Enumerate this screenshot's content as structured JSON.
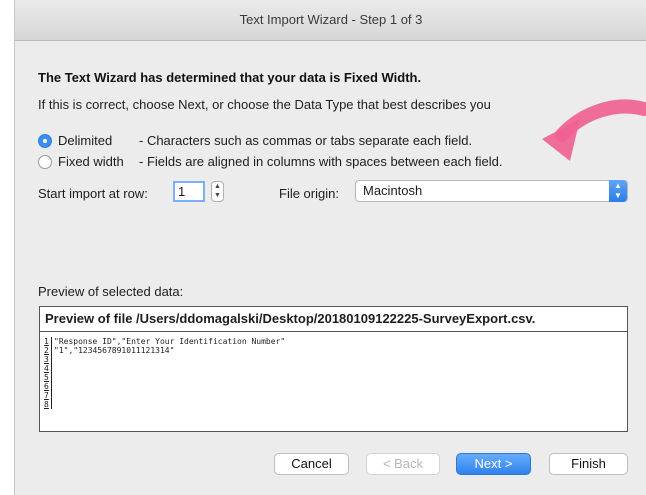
{
  "window": {
    "title": "Text Import Wizard - Step 1 of 3"
  },
  "intro": {
    "heading": "The Text Wizard has determined that your data is Fixed Width.",
    "subheading": "If this is correct, choose Next, or choose the Data Type that best describes you"
  },
  "data_type": {
    "options": [
      {
        "label": "Delimited",
        "description": "- Characters such as commas or tabs separate each field.",
        "selected": true
      },
      {
        "label": "Fixed width",
        "description": "- Fields are aligned in columns with spaces between each field.",
        "selected": false
      }
    ]
  },
  "import": {
    "start_label": "Start import at row:",
    "start_row": "1",
    "origin_label": "File origin:",
    "origin_value": "Macintosh"
  },
  "preview": {
    "label": "Preview of selected data:",
    "header": "Preview of file /Users/ddomagalski/Desktop/20180109122225-SurveyExport.csv.",
    "lines": [
      {
        "num": "1",
        "text": "\"Response ID\",\"Enter Your Identification Number\""
      },
      {
        "num": "2",
        "text": "\"1\",\"1234567891011121314\""
      },
      {
        "num": "3",
        "text": ""
      },
      {
        "num": "4",
        "text": ""
      },
      {
        "num": "5",
        "text": ""
      },
      {
        "num": "6",
        "text": ""
      },
      {
        "num": "7",
        "text": ""
      },
      {
        "num": "8",
        "text": ""
      }
    ]
  },
  "buttons": {
    "cancel": "Cancel",
    "back": "< Back",
    "next": "Next >",
    "finish": "Finish"
  },
  "colors": {
    "accent": "#3b8ef0",
    "annotation_arrow": "#f06292"
  }
}
